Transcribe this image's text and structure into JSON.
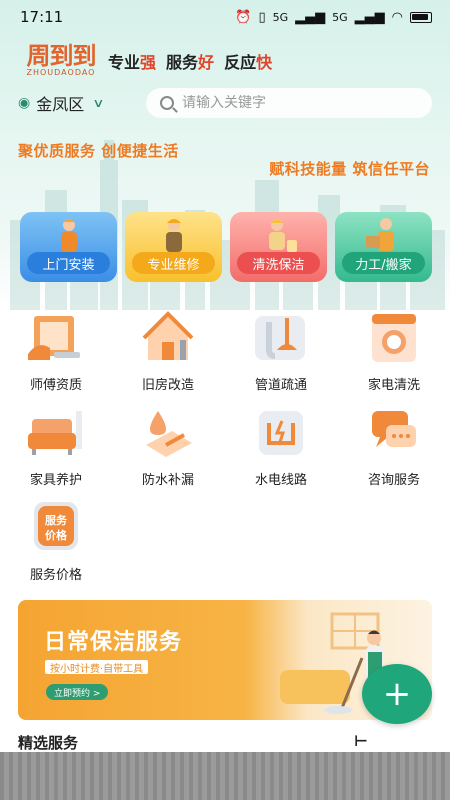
{
  "status_bar": {
    "time": "17:11",
    "signal1": "5G",
    "signal2": "5G"
  },
  "brand": {
    "logo_cn": "周到到",
    "logo_en": "ZHOUDAODAO",
    "slogan": [
      {
        "pre": "专业",
        "hl": "强"
      },
      {
        "pre": "服务",
        "hl": "好"
      },
      {
        "pre": "反应",
        "hl": "快"
      }
    ]
  },
  "location": {
    "city": "金凤区"
  },
  "search": {
    "placeholder": "请输入关键字"
  },
  "taglines": {
    "line1": "聚优质服务 创便捷生活",
    "line2": "赋科技能量 筑信任平台"
  },
  "services": [
    {
      "label": "上门安装",
      "icon": "installer-icon"
    },
    {
      "label": "专业维修",
      "icon": "repairman-icon"
    },
    {
      "label": "清洗保洁",
      "icon": "cleaner-icon"
    },
    {
      "label": "力工/搬家",
      "icon": "mover-icon"
    }
  ],
  "grid": [
    {
      "label": "师傅资质",
      "icon": "certificate-icon"
    },
    {
      "label": "旧房改造",
      "icon": "house-renovation-icon"
    },
    {
      "label": "管道疏通",
      "icon": "plunger-icon"
    },
    {
      "label": "家电清洗",
      "icon": "washing-machine-icon"
    },
    {
      "label": "家具养护",
      "icon": "sofa-icon"
    },
    {
      "label": "防水补漏",
      "icon": "waterproof-icon"
    },
    {
      "label": "水电线路",
      "icon": "water-electric-icon"
    },
    {
      "label": "咨询服务",
      "icon": "chat-icon"
    },
    {
      "label": "服务价格",
      "icon": "price-tag-icon",
      "icon_text": "服务价格"
    }
  ],
  "banner": {
    "title": "日常保洁服务",
    "subtitle": "按小时计费·自带工具",
    "button": "立即预约 >"
  },
  "fab": {
    "label": "+"
  },
  "section": {
    "title": "精选服务"
  },
  "colors": {
    "accent_green": "#1fa67a",
    "orange": "#ee7b22",
    "highlight_red": "#e0452b"
  }
}
